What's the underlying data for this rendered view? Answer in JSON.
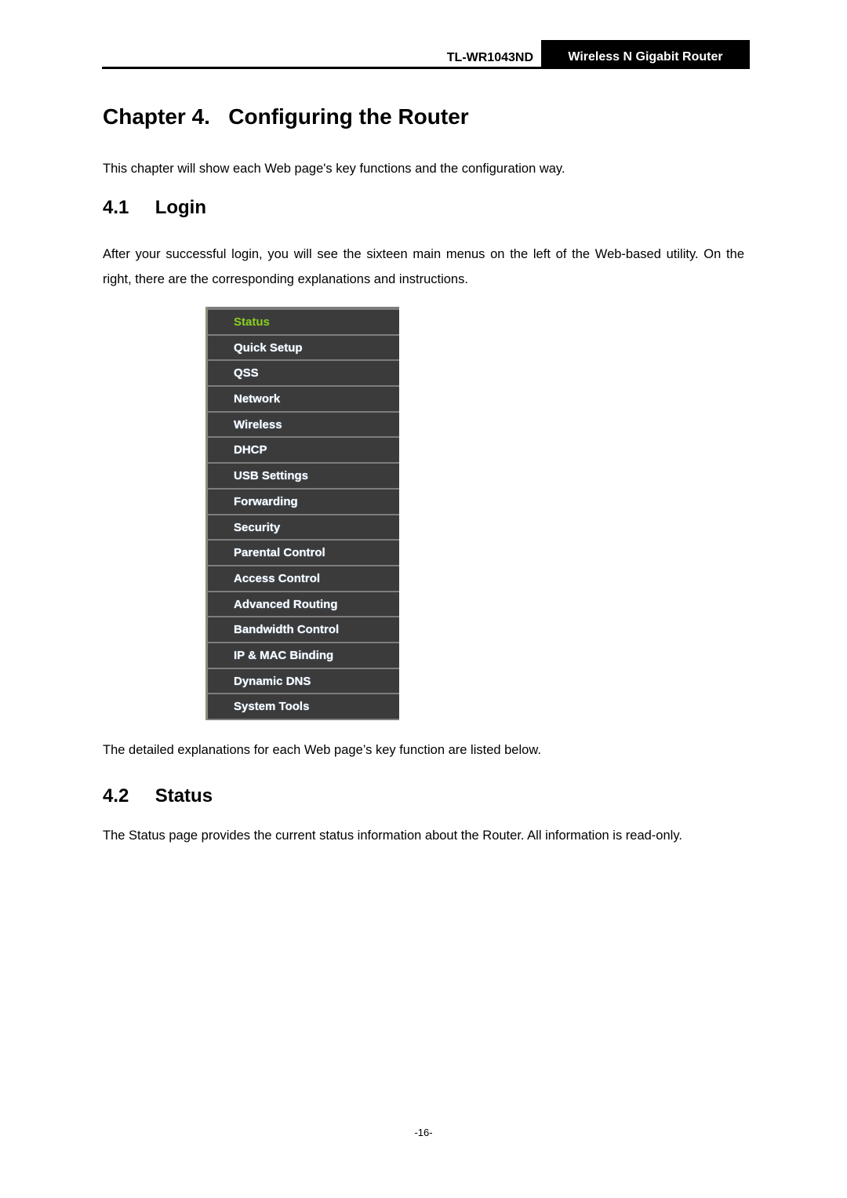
{
  "header": {
    "model": "TL-WR1043ND",
    "product": "Wireless N Gigabit Router"
  },
  "chapter": {
    "title": "Chapter 4.   Configuring the Router",
    "intro": "This chapter will show each Web page's key functions and the configuration way."
  },
  "sections": [
    {
      "title": "4.1     Login",
      "paragraph": "After your successful login, you will see the sixteen main menus on the left of the Web-based utility. On the right, there are the corresponding explanations and instructions.",
      "after_figure": "The detailed explanations for each Web page’s key function are listed below."
    },
    {
      "title": "4.2     Status",
      "paragraph": "The Status page provides the current status information about the Router. All information is read-only."
    }
  ],
  "menu": {
    "active_color": "#8ad11f",
    "items": [
      {
        "label": "Status",
        "active": true
      },
      {
        "label": "Quick Setup"
      },
      {
        "label": "QSS"
      },
      {
        "label": "Network"
      },
      {
        "label": "Wireless"
      },
      {
        "label": "DHCP"
      },
      {
        "label": "USB Settings"
      },
      {
        "label": "Forwarding"
      },
      {
        "label": "Security"
      },
      {
        "label": "Parental Control"
      },
      {
        "label": "Access Control"
      },
      {
        "label": "Advanced Routing"
      },
      {
        "label": "Bandwidth Control"
      },
      {
        "label": "IP & MAC Binding"
      },
      {
        "label": "Dynamic DNS"
      },
      {
        "label": "System Tools"
      }
    ]
  },
  "footer": {
    "page_number": "-16-"
  }
}
